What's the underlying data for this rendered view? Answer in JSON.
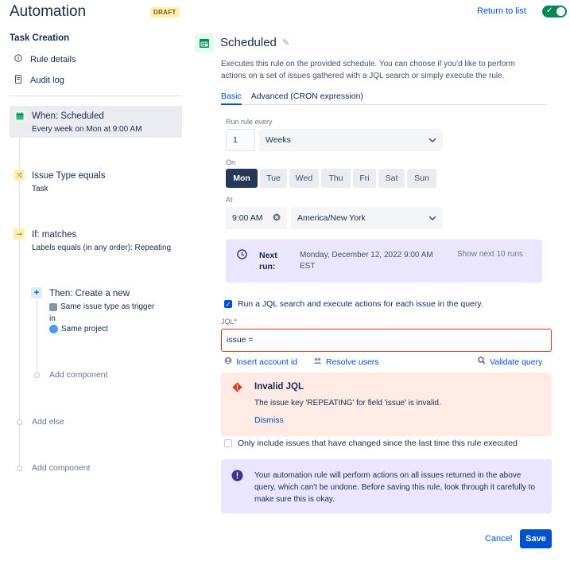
{
  "header": {
    "title": "Automation",
    "draft_badge": "DRAFT",
    "return_link": "Return to list",
    "toggle_on": true,
    "colors": {
      "primary": "#0052cc",
      "toggle": "#00875a"
    }
  },
  "sidebar": {
    "section_title": "Task Creation",
    "links": [
      {
        "label": "Rule details",
        "icon": "info-icon"
      },
      {
        "label": "Audit log",
        "icon": "document-icon"
      }
    ],
    "trigger": {
      "title": "When: Scheduled",
      "subtitle": "Every week on Mon at 9:00 AM",
      "icon": "calendar-icon"
    },
    "condition1": {
      "title": "Issue Type equals",
      "subtitle": "Task",
      "icon": "shuffle-icon"
    },
    "condition2": {
      "title": "If: matches",
      "subtitle": "Labels equals (in any order): Repeating",
      "icon": "branch-icon"
    },
    "action": {
      "title": "Then: Create a new",
      "line1": "Same issue type as trigger",
      "line2": "in",
      "line3": "Same project",
      "icon": "plus-icon"
    },
    "add_component_inner": "Add component",
    "add_else": "Add else",
    "add_component_outer": "Add component"
  },
  "panel": {
    "title": "Scheduled",
    "description": "Executes this rule on the provided schedule. You can choose if you'd like to perform actions on a set of issues gathered with a JQL search or simply execute the rule.",
    "tabs": [
      {
        "label": "Basic",
        "active": true
      },
      {
        "label": "Advanced (CRON expression)",
        "active": false
      }
    ],
    "run_every_label": "Run rule every",
    "run_every_value": "1",
    "run_every_unit": "Weeks",
    "on_label": "On",
    "days": [
      "Mon",
      "Tue",
      "Wed",
      "Thu",
      "Fri",
      "Sat",
      "Sun"
    ],
    "selected_day": "Mon",
    "at_label": "At",
    "time_value": "9:00 AM",
    "timezone": "America/New York",
    "next_run_label": "Next run:",
    "next_run_value": "Monday, December 12, 2022 9:00 AM EST",
    "show_next": "Show next 10 runs",
    "jql_checkbox_label": "Run a JQL search and execute actions for each issue in the query.",
    "jql_checked": true,
    "jql_label": "JQL",
    "jql_required": "*",
    "jql_value": "issue =",
    "insert_account": "Insert account id",
    "resolve_users": "Resolve users",
    "validate_query": "Validate query",
    "error_title": "Invalid JQL",
    "error_message": "The issue key 'REPEATING' for field 'issue' is invalid.",
    "dismiss": "Dismiss",
    "only_changed_label": "Only include issues that have changed since the last time this rule executed",
    "only_changed_checked": false,
    "info_message": "Your automation rule will perform actions on all issues returned in the above query, which can't be undone. Before saving this rule, look through it carefully to make sure this is okay.",
    "cancel": "Cancel",
    "save": "Save"
  }
}
